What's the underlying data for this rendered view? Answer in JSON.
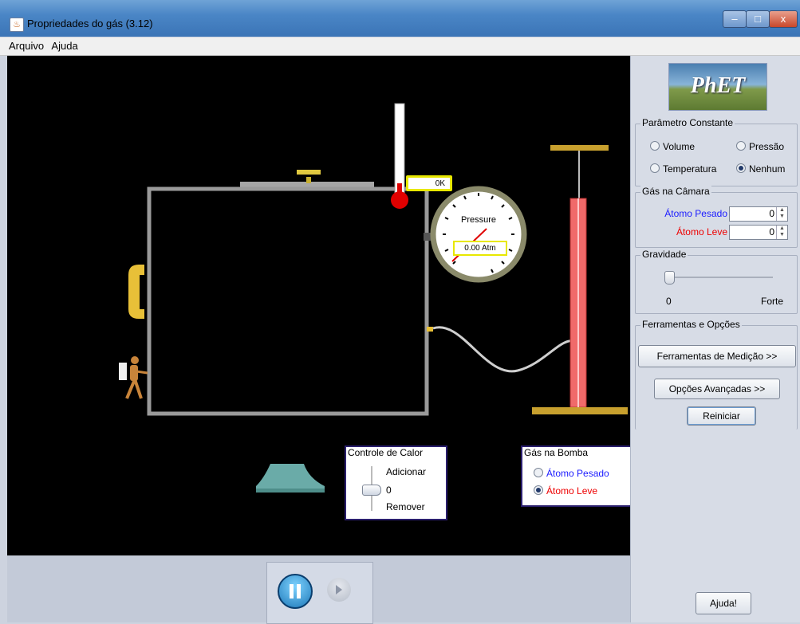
{
  "window": {
    "title": "Propriedades do gás (3.12)",
    "minimize": "–",
    "maximize": "□",
    "close": "x",
    "icon": "java-icon"
  },
  "menu": {
    "items": [
      "Arquivo",
      "Ajuda"
    ]
  },
  "logo": {
    "text": "PhET"
  },
  "constant_param": {
    "title": "Parâmetro Constante",
    "options": [
      {
        "label": "Volume",
        "selected": false
      },
      {
        "label": "Pressão",
        "selected": false
      },
      {
        "label": "Temperatura",
        "selected": false
      },
      {
        "label": "Nenhum",
        "selected": true
      }
    ]
  },
  "chamber_gas": {
    "title": "Gás na Câmara",
    "heavy_label": "Átomo Pesado",
    "heavy_value": "0",
    "light_label": "Átomo Leve",
    "light_value": "0",
    "heavy_color": "#1c1cff",
    "light_color": "#ee0000"
  },
  "gravity": {
    "title": "Gravidade",
    "min_label": "0",
    "max_label": "Forte",
    "level": 0
  },
  "tools": {
    "title": "Ferramentas e Opções",
    "measurement_button": "Ferramentas de Medição >>",
    "advanced_button": "Opções Avançadas >>"
  },
  "reset_button": "Reiniciar",
  "help_button": "Ajuda!",
  "thermometer": {
    "reading": "0K"
  },
  "gauge": {
    "label": "Pressure",
    "reading": "0.00 Atm"
  },
  "heat_control": {
    "title": "Controle de Calor",
    "add_label": "Adicionar",
    "value": "0",
    "remove_label": "Remover"
  },
  "pump_gas": {
    "title": "Gás na Bomba",
    "options": [
      {
        "label": "Átomo Pesado",
        "selected": false
      },
      {
        "label": "Átomo Leve",
        "selected": true
      }
    ]
  },
  "playback": {
    "pause_icon": "pause-icon",
    "step_icon": "step-icon"
  },
  "colors": {
    "canvas": "#000000",
    "pump_body": "#f06a6a",
    "handle": "#c8a02e",
    "box_wall": "#9a9a9a"
  }
}
